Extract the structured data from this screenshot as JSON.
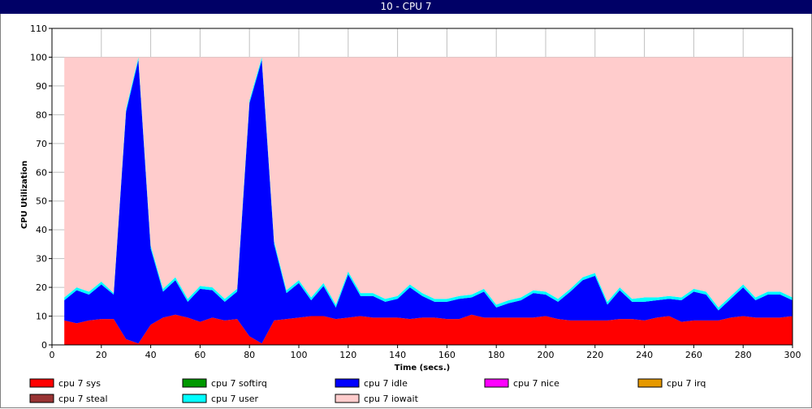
{
  "window": {
    "title": "10 - CPU 7"
  },
  "chart_data": {
    "type": "area",
    "stacked": true,
    "xlabel": "Time (secs.)",
    "ylabel": "CPU Utilization",
    "xlim": [
      0,
      300
    ],
    "ylim": [
      0,
      110
    ],
    "xticks": [
      0,
      20,
      40,
      60,
      80,
      100,
      120,
      140,
      160,
      180,
      200,
      220,
      240,
      260,
      280,
      300
    ],
    "yticks": [
      0,
      10,
      20,
      30,
      40,
      50,
      60,
      70,
      80,
      90,
      100,
      110
    ],
    "grid": true,
    "legend_position": "bottom",
    "x": [
      5,
      10,
      15,
      20,
      25,
      30,
      35,
      40,
      45,
      50,
      55,
      60,
      65,
      70,
      75,
      80,
      85,
      90,
      95,
      100,
      105,
      110,
      115,
      120,
      125,
      130,
      135,
      140,
      145,
      150,
      155,
      160,
      165,
      170,
      175,
      180,
      185,
      190,
      195,
      200,
      205,
      210,
      215,
      220,
      225,
      230,
      235,
      240,
      245,
      250,
      255,
      260,
      265,
      270,
      275,
      280,
      285,
      290,
      295,
      300
    ],
    "series": [
      {
        "name": "cpu 7 sys",
        "color": "#ff0000",
        "values": [
          8.5,
          7.5,
          8.5,
          9,
          9,
          2,
          0.5,
          7,
          9.5,
          10.5,
          9.5,
          8,
          9.5,
          8.5,
          9,
          3,
          0.5,
          8.5,
          9,
          9.5,
          10,
          10,
          9,
          9.5,
          10,
          9.5,
          9.5,
          9.5,
          9,
          9.5,
          9.5,
          9,
          9,
          10.5,
          9.5,
          9.5,
          9.5,
          9.5,
          9.5,
          10,
          9,
          8.5,
          8.5,
          8.5,
          8.5,
          9,
          9,
          8.5,
          9.5,
          10,
          8,
          8.5,
          8.5,
          8.5,
          9.5,
          10,
          9.5,
          9.5,
          9.5,
          10
        ]
      },
      {
        "name": "cpu 7 softirq",
        "color": "#009900",
        "values": [
          0,
          0,
          0,
          0,
          0,
          0,
          0,
          0,
          0,
          0,
          0,
          0,
          0,
          0,
          0,
          0,
          0,
          0,
          0,
          0,
          0,
          0,
          0,
          0,
          0,
          0,
          0,
          0,
          0,
          0,
          0,
          0,
          0,
          0,
          0,
          0,
          0,
          0,
          0,
          0,
          0,
          0,
          0,
          0,
          0,
          0,
          0,
          0,
          0,
          0,
          0,
          0,
          0,
          0,
          0,
          0,
          0,
          0,
          0,
          0
        ]
      },
      {
        "name": "cpu 7 idle",
        "color": "#0000ff",
        "values": [
          7,
          11.5,
          9,
          12,
          8.5,
          79,
          98.5,
          26.5,
          9,
          12,
          5.5,
          11.5,
          9.5,
          6.5,
          9.5,
          81,
          98.5,
          26.5,
          9,
          12,
          5.5,
          10.5,
          4,
          15,
          7,
          7.5,
          5.5,
          6.5,
          11,
          7.5,
          5.5,
          6,
          7,
          6,
          9,
          3.5,
          5,
          6,
          8.5,
          7.5,
          6,
          10,
          14,
          15.5,
          5.5,
          10,
          6,
          6.5,
          6,
          6,
          7.5,
          10,
          9,
          3.5,
          6.5,
          10,
          6,
          8,
          8,
          5.5
        ]
      },
      {
        "name": "cpu 7 nice",
        "color": "#ff00ff",
        "values": [
          0,
          0,
          0,
          0,
          0,
          0,
          0,
          0,
          0,
          0,
          0,
          0,
          0,
          0,
          0,
          0,
          0,
          0,
          0,
          0,
          0,
          0,
          0,
          0,
          0,
          0,
          0,
          0,
          0,
          0,
          0,
          0,
          0,
          0,
          0,
          0,
          0,
          0,
          0,
          0,
          0,
          0,
          0,
          0,
          0,
          0,
          0,
          0,
          0,
          0,
          0,
          0,
          0,
          0,
          0,
          0,
          0,
          0,
          0,
          0
        ]
      },
      {
        "name": "cpu 7 irq",
        "color": "#e69900",
        "values": [
          0,
          0,
          0,
          0,
          0,
          0,
          0,
          0,
          0,
          0,
          0,
          0,
          0,
          0,
          0,
          0,
          0,
          0,
          0,
          0,
          0,
          0,
          0,
          0,
          0,
          0,
          0,
          0,
          0,
          0,
          0,
          0,
          0,
          0,
          0,
          0,
          0,
          0,
          0,
          0,
          0,
          0,
          0,
          0,
          0,
          0,
          0,
          0,
          0,
          0,
          0,
          0,
          0,
          0,
          0,
          0,
          0,
          0,
          0,
          0
        ]
      },
      {
        "name": "cpu 7 steal",
        "color": "#993333",
        "values": [
          0,
          0,
          0,
          0,
          0,
          0,
          0,
          0,
          0,
          0,
          0,
          0,
          0,
          0,
          0,
          0,
          0,
          0,
          0,
          0,
          0,
          0,
          0,
          0,
          0,
          0,
          0,
          0,
          0,
          0,
          0,
          0,
          0,
          0,
          0,
          0,
          0,
          0,
          0,
          0,
          0,
          0,
          0,
          0,
          0,
          0,
          0,
          0,
          0,
          0,
          0,
          0,
          0,
          0,
          0,
          0,
          0,
          0,
          0,
          0
        ]
      },
      {
        "name": "cpu 7 user",
        "color": "#00ffff",
        "values": [
          1,
          1,
          1,
          1,
          0.5,
          1,
          1,
          1,
          1,
          1,
          1,
          1,
          1,
          1,
          1,
          1,
          1,
          1,
          1,
          1,
          1,
          1,
          1,
          1,
          1,
          1,
          1,
          1,
          1,
          1,
          1,
          1,
          1,
          1,
          1,
          1,
          1,
          1,
          1,
          1,
          1,
          1,
          1,
          1,
          1,
          1,
          1,
          1.5,
          1,
          1,
          1,
          1,
          1,
          1,
          1,
          1,
          1,
          1,
          1,
          1
        ]
      },
      {
        "name": "cpu 7 iowait",
        "color": "#ffcccc",
        "values": [
          83.5,
          80,
          81.5,
          78,
          82,
          18,
          0,
          65.5,
          80.5,
          76.5,
          84,
          79.5,
          80,
          84,
          80.5,
          15,
          0,
          64,
          81,
          77.5,
          83.5,
          78.5,
          86,
          74.5,
          82,
          82,
          84,
          83,
          79,
          82,
          84,
          84,
          83,
          82.5,
          80.5,
          86,
          84.5,
          83.5,
          81,
          81.5,
          84,
          80.5,
          76.5,
          75,
          85,
          80,
          84,
          83.5,
          83.5,
          83,
          83.5,
          80.5,
          81.5,
          87,
          83,
          79,
          83.5,
          81.5,
          81.5,
          83.5
        ]
      }
    ]
  }
}
